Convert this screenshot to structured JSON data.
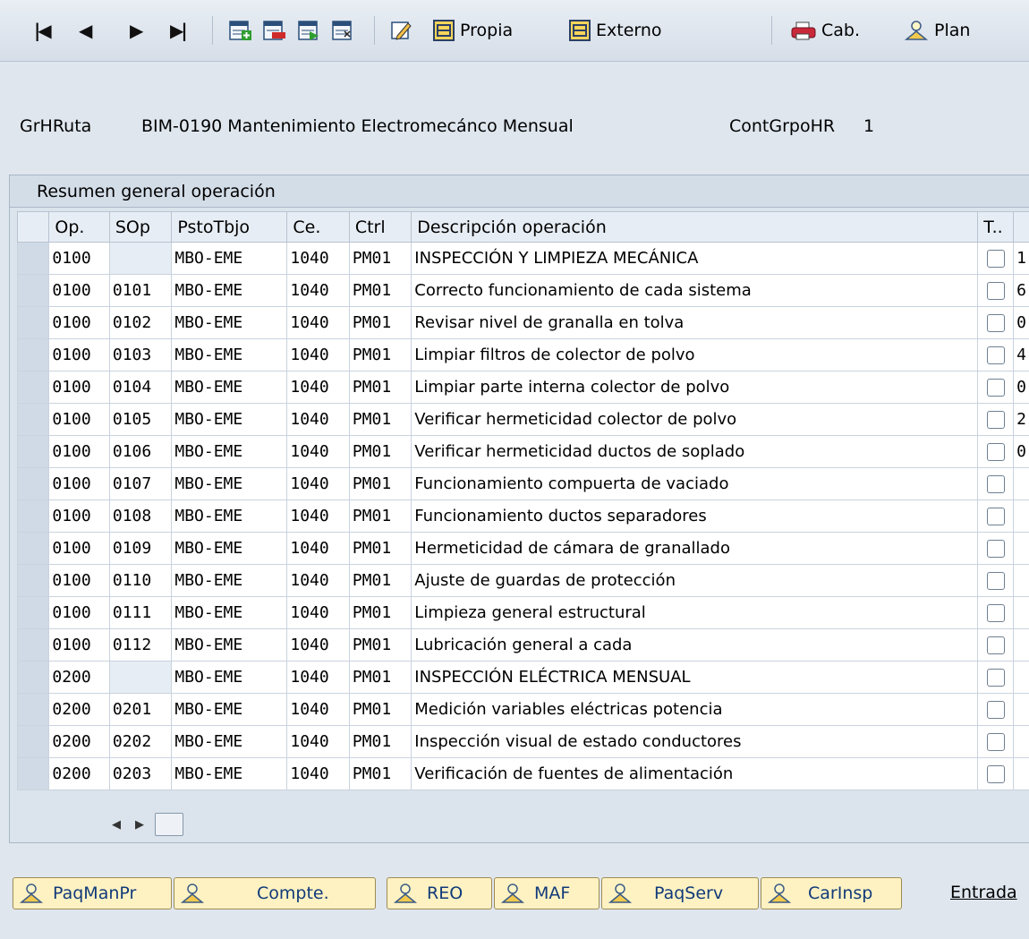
{
  "toolbar": {
    "nav": [
      "⏮",
      "◀",
      "▶",
      "⏭"
    ],
    "propia": "Propia",
    "externo": "Externo",
    "cab": "Cab.",
    "plan": "Plan"
  },
  "header": {
    "grhruta_label": "GrHRuta",
    "grhruta_value": "BIM-0190 Mantenimiento Electromecánco Mensual",
    "contgrpohr_label": "ContGrpoHR",
    "contgrpohr_value": "1"
  },
  "table": {
    "title": "Resumen general operación",
    "columns": [
      "Op.",
      "SOp",
      "PstoTbjo",
      "Ce.",
      "Ctrl",
      "Descripción operación",
      "T.."
    ],
    "rows": [
      {
        "op": "0100",
        "sop": "",
        "psto": "MBO-EME",
        "ce": "1040",
        "ctrl": "PM01",
        "desc": "INSPECCIÓN Y LIMPIEZA MECÁNICA",
        "extra": "1"
      },
      {
        "op": "0100",
        "sop": "0101",
        "psto": "MBO-EME",
        "ce": "1040",
        "ctrl": "PM01",
        "desc": "Correcto funcionamiento de cada sistema",
        "extra": "6"
      },
      {
        "op": "0100",
        "sop": "0102",
        "psto": "MBO-EME",
        "ce": "1040",
        "ctrl": "PM01",
        "desc": "Revisar nivel de granalla en tolva",
        "extra": "0"
      },
      {
        "op": "0100",
        "sop": "0103",
        "psto": "MBO-EME",
        "ce": "1040",
        "ctrl": "PM01",
        "desc": "Limpiar filtros de colector de polvo",
        "extra": "4"
      },
      {
        "op": "0100",
        "sop": "0104",
        "psto": "MBO-EME",
        "ce": "1040",
        "ctrl": "PM01",
        "desc": "Limpiar parte interna colector de polvo",
        "extra": "0"
      },
      {
        "op": "0100",
        "sop": "0105",
        "psto": "MBO-EME",
        "ce": "1040",
        "ctrl": "PM01",
        "desc": "Verificar hermeticidad colector de polvo",
        "extra": "2"
      },
      {
        "op": "0100",
        "sop": "0106",
        "psto": "MBO-EME",
        "ce": "1040",
        "ctrl": "PM01",
        "desc": "Verificar hermeticidad ductos de soplado",
        "extra": "0"
      },
      {
        "op": "0100",
        "sop": "0107",
        "psto": "MBO-EME",
        "ce": "1040",
        "ctrl": "PM01",
        "desc": "Funcionamiento compuerta de vaciado",
        "extra": ""
      },
      {
        "op": "0100",
        "sop": "0108",
        "psto": "MBO-EME",
        "ce": "1040",
        "ctrl": "PM01",
        "desc": "Funcionamiento ductos separadores",
        "extra": ""
      },
      {
        "op": "0100",
        "sop": "0109",
        "psto": "MBO-EME",
        "ce": "1040",
        "ctrl": "PM01",
        "desc": "Hermeticidad de cámara de granallado",
        "extra": ""
      },
      {
        "op": "0100",
        "sop": "0110",
        "psto": "MBO-EME",
        "ce": "1040",
        "ctrl": "PM01",
        "desc": "Ajuste de guardas de protección",
        "extra": ""
      },
      {
        "op": "0100",
        "sop": "0111",
        "psto": "MBO-EME",
        "ce": "1040",
        "ctrl": "PM01",
        "desc": "Limpieza general estructural",
        "extra": ""
      },
      {
        "op": "0100",
        "sop": "0112",
        "psto": "MBO-EME",
        "ce": "1040",
        "ctrl": "PM01",
        "desc": "Lubricación general a cada",
        "extra": ""
      },
      {
        "op": "0200",
        "sop": "",
        "psto": "MBO-EME",
        "ce": "1040",
        "ctrl": "PM01",
        "desc": "INSPECCIÓN ELÉCTRICA MENSUAL",
        "extra": ""
      },
      {
        "op": "0200",
        "sop": "0201",
        "psto": "MBO-EME",
        "ce": "1040",
        "ctrl": "PM01",
        "desc": "Medición variables eléctricas potencia",
        "extra": ""
      },
      {
        "op": "0200",
        "sop": "0202",
        "psto": "MBO-EME",
        "ce": "1040",
        "ctrl": "PM01",
        "desc": "Inspección visual de estado conductores",
        "extra": ""
      },
      {
        "op": "0200",
        "sop": "0203",
        "psto": "MBO-EME",
        "ce": "1040",
        "ctrl": "PM01",
        "desc": "Verificación de fuentes de alimentación",
        "extra": ""
      }
    ]
  },
  "buttons": {
    "paqmanpr": "PaqManPr",
    "compte": "Compte.",
    "reo": "REO",
    "maf": "MAF",
    "paqserv": "PaqServ",
    "carinsp": "CarInsp"
  },
  "entrada": "Entrada"
}
